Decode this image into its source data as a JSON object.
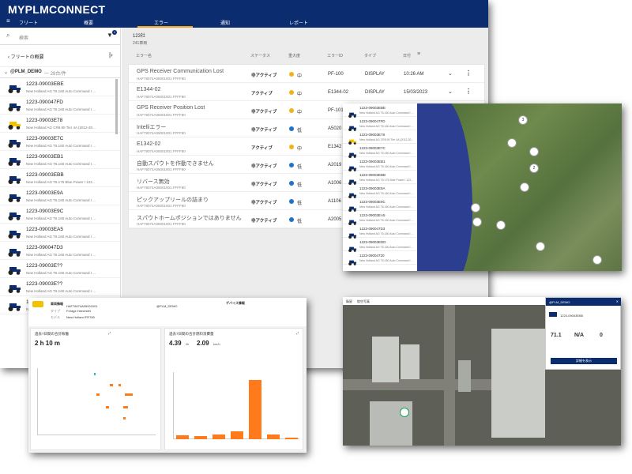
{
  "app": {
    "logo": "MYPLMCONNECT",
    "nav": [
      "フリート",
      "概要",
      "エラー",
      "通知",
      "レポート"
    ],
    "menu_icon": "≡"
  },
  "left": {
    "search_placeholder": "検索",
    "filter_badge": "1",
    "fleet_overview": "フリートの概要",
    "group_name": "@PLM_DEMO",
    "group_count": "一 29台/件",
    "vehicles": [
      {
        "id": "1223-09003EBE",
        "model": "New Holland AG T6.160 Auto Command I ..."
      },
      {
        "id": "1223-090047FD",
        "model": "New Holland AG T6.160 Auto Command I ..."
      },
      {
        "id": "1223-09003E78",
        "model": "New Holland AG CR8.90 Tier 4A (2012-20..."
      },
      {
        "id": "1223-09003E7C",
        "model": "New Holland AG T6.160 Auto Command I ..."
      },
      {
        "id": "1223-09003EB1",
        "model": "New Holland AG T6.160 Auto Command I ..."
      },
      {
        "id": "1223-09003EBB",
        "model": "New Holland AG T5.175 Blue Power I 122..."
      },
      {
        "id": "1223-09003E9A",
        "model": "New Holland AG T6.160 Auto Command I ..."
      },
      {
        "id": "1223-09003E9C",
        "model": "New Holland AG T6.160 Auto Command I ..."
      },
      {
        "id": "1223-09003EA5",
        "model": "New Holland AG T6.160 Auto Command I ..."
      },
      {
        "id": "1223-090047D3",
        "model": "New Holland AG T6.160 Auto Command I ..."
      },
      {
        "id": "1223-09003E??",
        "model": "New Holland AG T6.160 Auto Command I ..."
      },
      {
        "id": "1223-09003E??",
        "model": "New Holland AG T6.160 Auto Command I ..."
      },
      {
        "id": "1223-09003E??",
        "model": "New Holland AG T6.160 Auto Command I ..."
      }
    ]
  },
  "errors": {
    "count_title": "123社",
    "count_sub": "241車両",
    "columns": [
      "エラー名",
      "ステータス",
      "重大度",
      "エラーID",
      "タイプ",
      "日付"
    ],
    "sort_icon": "≡",
    "rows": [
      {
        "name": "GPS Receiver Communication Lost",
        "sub": "HAF78074A05001001 FFFF80",
        "status": "非アクティブ",
        "sev": "中",
        "sevColor": "#f2b21c",
        "code": "PF-100",
        "type": "DISPLAY",
        "date": "10:26 AM"
      },
      {
        "name": "E1344-02",
        "sub": "HAF78074A05001001 FFFF80",
        "status": "アクティブ",
        "sev": "中",
        "sevColor": "#f2b21c",
        "code": "E1344-02",
        "type": "DISPLAY",
        "date": "15/03/2023"
      },
      {
        "name": "GPS Receiver Position Lost",
        "sub": "HAF78074A05001001 FFFF80",
        "status": "非アクティブ",
        "sev": "中",
        "sevColor": "#f2b21c",
        "code": "PF-101",
        "type": "",
        "date": ""
      },
      {
        "name": "Intelliエラー",
        "sub": "HAF78074A05001001 FFFF80",
        "status": "非アクティブ",
        "sev": "低",
        "sevColor": "#1e73c8",
        "code": "A5020",
        "type": "",
        "date": ""
      },
      {
        "name": "E1342-02",
        "sub": "HAF78074A05001001 FFFF80",
        "status": "アクティブ",
        "sev": "中",
        "sevColor": "#f2b21c",
        "code": "E1342",
        "type": "",
        "date": ""
      },
      {
        "name": "自動スパウトを作動できません",
        "sub": "HAF78074A05001001 FFFF80",
        "status": "非アクティブ",
        "sev": "低",
        "sevColor": "#1e73c8",
        "code": "A2019",
        "type": "",
        "date": ""
      },
      {
        "name": "リバース無効",
        "sub": "HAF78074A05001001 FFFF80",
        "status": "非アクティブ",
        "sev": "低",
        "sevColor": "#1e73c8",
        "code": "A1006",
        "type": "",
        "date": ""
      },
      {
        "name": "ピックアップリールの詰まり",
        "sub": "HAF78074A05001001 FFFF80",
        "status": "非アクティブ",
        "sev": "低",
        "sevColor": "#1e73c8",
        "code": "A1106",
        "type": "",
        "date": ""
      },
      {
        "name": "スパウトホームポジションではありません",
        "sub": "HAF78074A05001001 FFFF80",
        "status": "非アクティブ",
        "sev": "低",
        "sevColor": "#1e73c8",
        "code": "A2005",
        "type": "",
        "date": ""
      }
    ]
  },
  "map_list": [
    {
      "id": "1223-09003EBE",
      "model": "New Holland AG T6.160 Auto Command I ..."
    },
    {
      "id": "1223-090047FD",
      "model": "New Holland AG T6.160 Auto Command I ..."
    },
    {
      "id": "1223-09003E78",
      "model": "New Holland AG CR8.90 Tier 4A (2012-20..."
    },
    {
      "id": "1223-09003E7C",
      "model": "New Holland AG T6.160 Auto Command I ..."
    },
    {
      "id": "1223-09003EB1",
      "model": "New Holland AG T6.160 Auto Command I ..."
    },
    {
      "id": "1223-09003EBB",
      "model": "New Holland AG T5.175 Blue Power I 122..."
    },
    {
      "id": "1223-09003E9A",
      "model": "New Holland AG T6.160 Auto Command I ..."
    },
    {
      "id": "1223-09003E9C",
      "model": "New Holland AG T6.160 Auto Command I ..."
    },
    {
      "id": "1223-09003EA5",
      "model": "New Holland AG T6.160 Auto Command I ..."
    },
    {
      "id": "1223-090047D3",
      "model": "New Holland AG T6.160 Auto Command I ..."
    },
    {
      "id": "1223-09003EDD",
      "model": "New Holland AG T6.160 Auto Command I ..."
    },
    {
      "id": "1223-09004720",
      "model": "New Holland AG T6.160 Auto Command I ..."
    }
  ],
  "map_pins": [
    "3",
    "2"
  ],
  "dash": {
    "header_title": "車両情報",
    "device_title": "デバイス情報",
    "field_type": "タイプ",
    "field_type_val": "Forage Harvester",
    "field_model": "モデル",
    "field_model_val": "New Holland FR780",
    "vin": "HAF78074A05001001",
    "org": "@PLM_DEMO",
    "panel1_title": "過去7日間の合計稼働",
    "panel1_value": "2 h 10 m",
    "panel2_title": "過去7日間の合計燃料消費量",
    "panel2_value1": "4.39",
    "panel2_unit1": "l/h",
    "panel2_value2": "2.09",
    "panel2_unit2": "km/h",
    "expand_icon": "⤢"
  },
  "chart_data": {
    "type": "bar",
    "title": "過去7日間の合計燃料消費量",
    "categories": [
      "1",
      "2",
      "3",
      "4",
      "5",
      "6",
      "7"
    ],
    "values": [
      4,
      3,
      5,
      8,
      62,
      5,
      2
    ],
    "ylim": [
      0,
      70
    ]
  },
  "sat": {
    "tabs": [
      "衛星",
      "航空写真"
    ],
    "popup_title": "@PLM_DEMO",
    "popup_id": "1223-09003EBE",
    "popup_val1": "71.1",
    "popup_val2": "N/A",
    "popup_val3": "0",
    "popup_btn": "詳細を表示"
  }
}
